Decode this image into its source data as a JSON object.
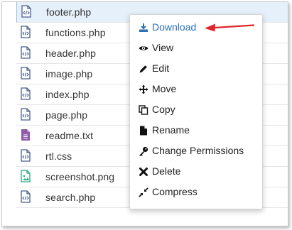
{
  "files": [
    {
      "name": "footer.php",
      "icon": "php-file-icon",
      "selected": true
    },
    {
      "name": "functions.php",
      "icon": "php-file-icon"
    },
    {
      "name": "header.php",
      "icon": "php-file-icon"
    },
    {
      "name": "image.php",
      "icon": "php-file-icon"
    },
    {
      "name": "index.php",
      "icon": "php-file-icon"
    },
    {
      "name": "page.php",
      "icon": "php-file-icon"
    },
    {
      "name": "readme.txt",
      "icon": "text-file-icon"
    },
    {
      "name": "rtl.css",
      "icon": "css-file-icon"
    },
    {
      "name": "screenshot.png",
      "icon": "image-file-icon"
    },
    {
      "name": "search.php",
      "icon": "php-file-icon"
    }
  ],
  "context_menu": {
    "items": [
      {
        "label": "Download",
        "icon": "download-icon",
        "active": true
      },
      {
        "label": "View",
        "icon": "eye-icon"
      },
      {
        "label": "Edit",
        "icon": "pencil-icon"
      },
      {
        "label": "Move",
        "icon": "move-arrows-icon"
      },
      {
        "label": "Copy",
        "icon": "copy-icon"
      },
      {
        "label": "Rename",
        "icon": "file-icon"
      },
      {
        "label": "Change Permissions",
        "icon": "key-icon"
      },
      {
        "label": "Delete",
        "icon": "x-icon"
      },
      {
        "label": "Compress",
        "icon": "compress-icon"
      }
    ]
  },
  "colors": {
    "accent": "#2a72b5",
    "annotation_arrow": "#e0252b",
    "file_icon": "#4a5d8c",
    "text_file_icon": "#8e5ba8",
    "image_file_icon": "#27a884"
  }
}
